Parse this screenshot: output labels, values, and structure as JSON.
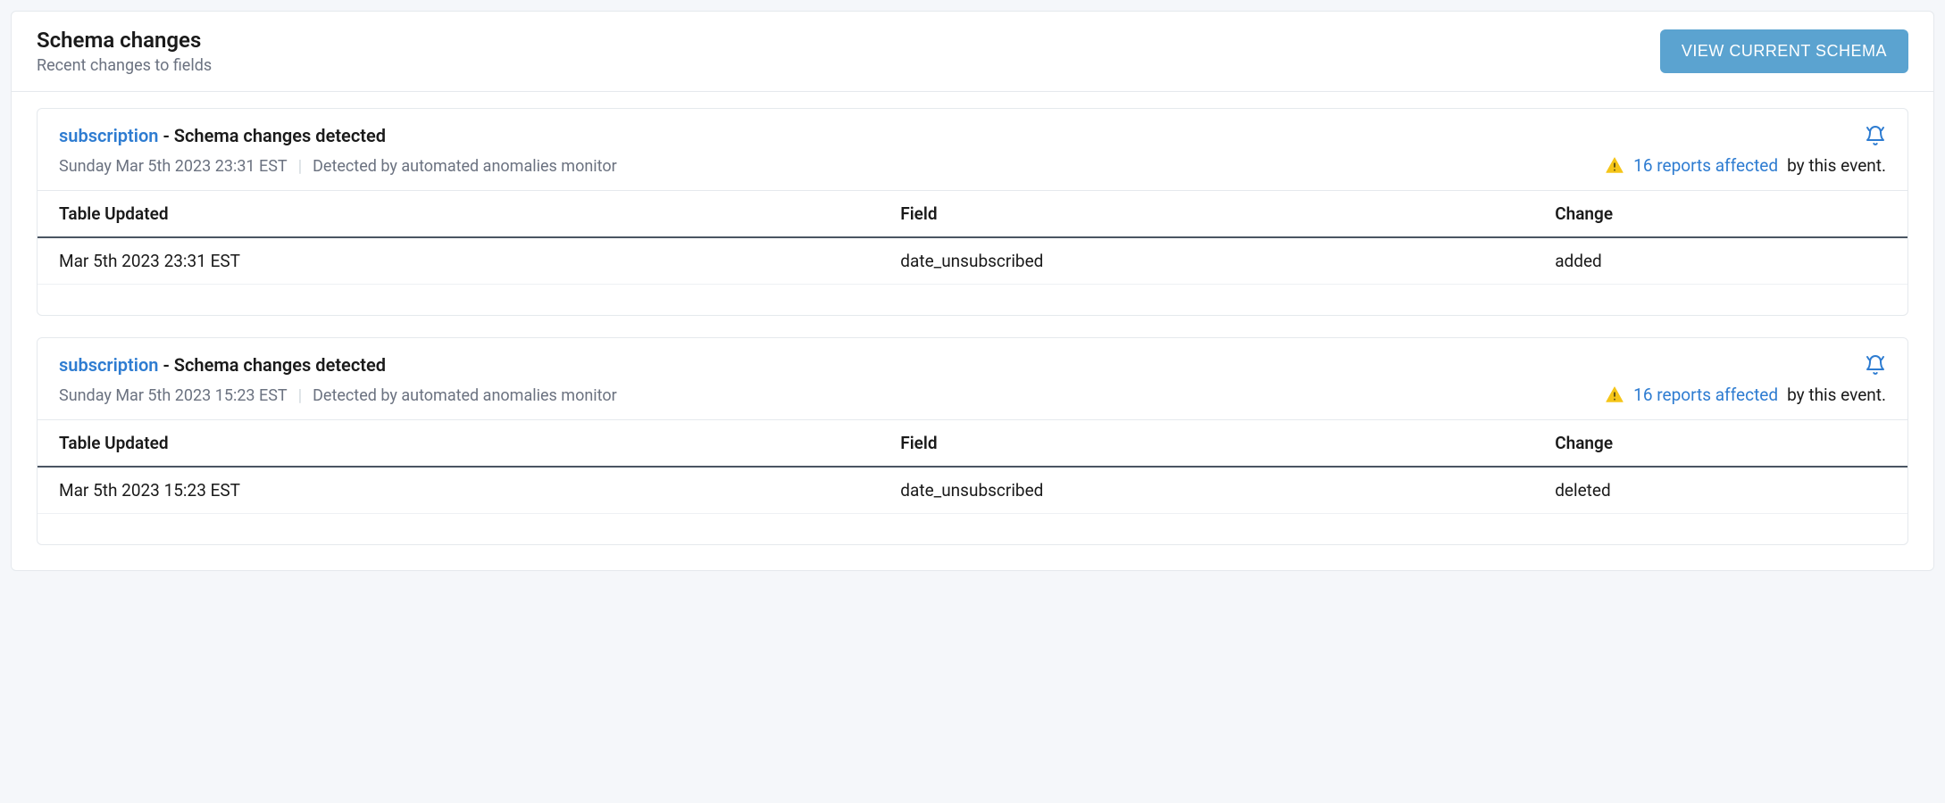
{
  "header": {
    "title": "Schema changes",
    "subtitle": "Recent changes to fields",
    "view_schema_label": "VIEW CURRENT SCHEMA"
  },
  "columns": {
    "updated": "Table Updated",
    "field": "Field",
    "change": "Change"
  },
  "events": [
    {
      "entity": "subscription",
      "title": "Schema changes detected",
      "timestamp": "Sunday Mar 5th 2023 23:31 EST",
      "detected_by": "Detected by automated anomalies monitor",
      "reports_link": "16 reports affected",
      "reports_suffix": " by this event.",
      "rows": [
        {
          "updated": "Mar 5th 2023 23:31 EST",
          "field": "date_unsubscribed",
          "change": "added"
        }
      ]
    },
    {
      "entity": "subscription",
      "title": "Schema changes detected",
      "timestamp": "Sunday Mar 5th 2023 15:23 EST",
      "detected_by": "Detected by automated anomalies monitor",
      "reports_link": "16 reports affected",
      "reports_suffix": " by this event.",
      "rows": [
        {
          "updated": "Mar 5th 2023 15:23 EST",
          "field": "date_unsubscribed",
          "change": "deleted"
        }
      ]
    }
  ]
}
